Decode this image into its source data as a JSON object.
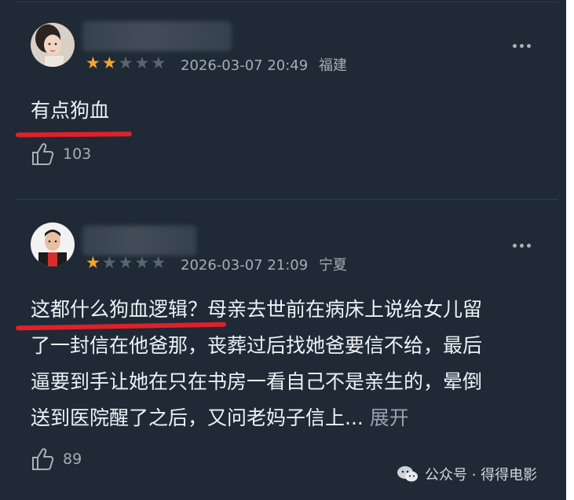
{
  "comments": [
    {
      "rating": 2,
      "max_rating": 5,
      "time": "2026-03-07 20:49",
      "location": "福建",
      "lines": [
        "有点狗血"
      ],
      "expand_label": "",
      "likes": "103"
    },
    {
      "rating": 1,
      "max_rating": 5,
      "time": "2026-03-07 21:09",
      "location": "宁夏",
      "lines": [
        "这都什么狗血逻辑？母亲去世前在病床上说给女儿留",
        "了一封信在他爸那，丧葬过后找她爸要信不给，最后",
        "逼要到手让她在只在书房一看自己不是亲生的，晕倒",
        "送到医院醒了之后，又问老妈子信上..."
      ],
      "expand_label": "展开",
      "likes": "89"
    }
  ],
  "watermark": {
    "text": "公众号 · 得得电影"
  },
  "colors": {
    "background": "#1f2a36",
    "star_filled": "#f5a623",
    "star_empty": "#5b6570",
    "underline": "#e0202a"
  }
}
